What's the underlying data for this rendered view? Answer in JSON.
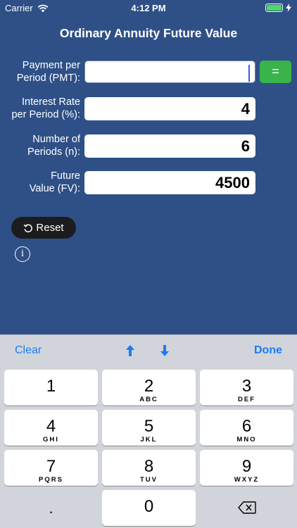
{
  "status": {
    "carrier": "Carrier",
    "time": "4:12 PM"
  },
  "title": "Ordinary Annuity Future Value",
  "form": {
    "pmt_label_1": "Payment per",
    "pmt_label_2": "Period (PMT):",
    "pmt_value": "",
    "rate_label_1": "Interest Rate",
    "rate_label_2": "per Period (%):",
    "rate_value": "4",
    "periods_label_1": "Number of",
    "periods_label_2": "Periods (n):",
    "periods_value": "6",
    "fv_label_1": "Future",
    "fv_label_2": "Value (FV):",
    "fv_value": "4500",
    "equals_label": "="
  },
  "reset_label": "Reset",
  "info_label": "i",
  "keyboard": {
    "clear": "Clear",
    "done": "Done",
    "keys": [
      {
        "digit": "1",
        "letters": ""
      },
      {
        "digit": "2",
        "letters": "ABC"
      },
      {
        "digit": "3",
        "letters": "DEF"
      },
      {
        "digit": "4",
        "letters": "GHI"
      },
      {
        "digit": "5",
        "letters": "JKL"
      },
      {
        "digit": "6",
        "letters": "MNO"
      },
      {
        "digit": "7",
        "letters": "PQRS"
      },
      {
        "digit": "8",
        "letters": "TUV"
      },
      {
        "digit": "9",
        "letters": "WXYZ"
      },
      {
        "digit": ".",
        "letters": ""
      },
      {
        "digit": "0",
        "letters": ""
      }
    ]
  },
  "colors": {
    "background": "#2e5087",
    "accent": "#1a7cf5",
    "equals": "#3ab44a"
  }
}
